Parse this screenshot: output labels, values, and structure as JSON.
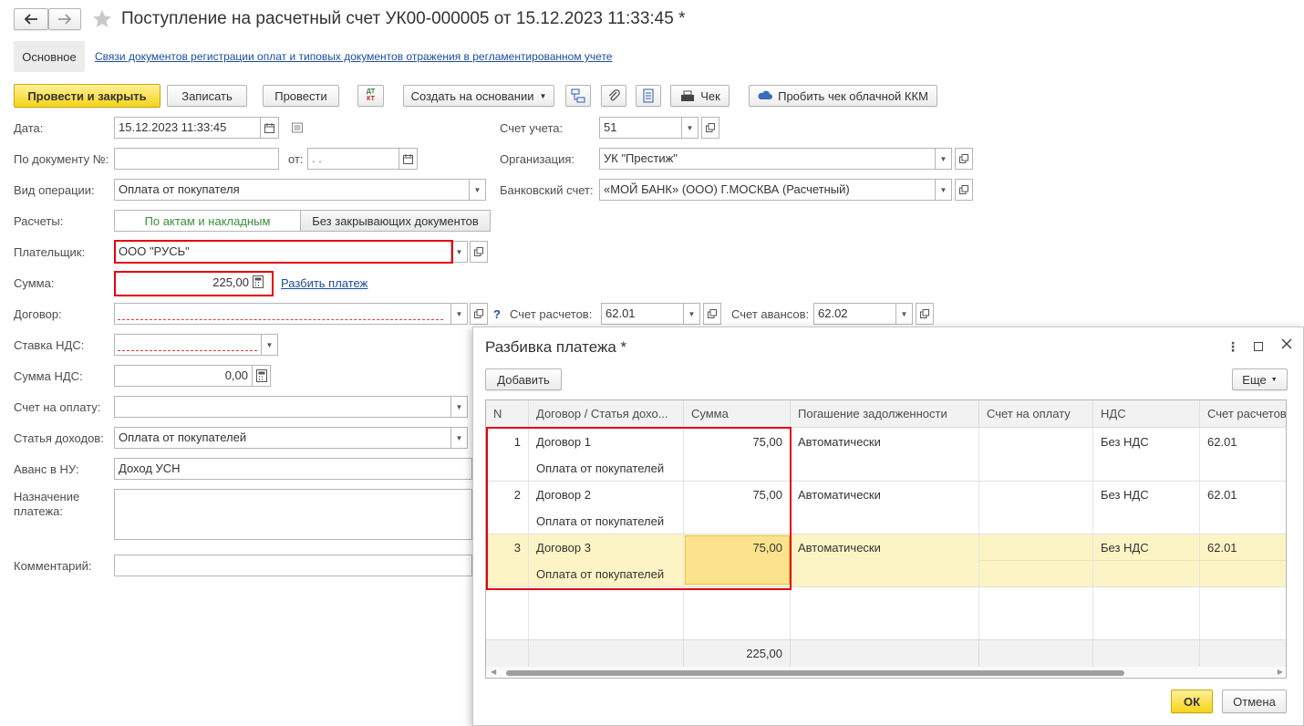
{
  "window": {
    "title": "Поступление на расчетный счет УК00-000005 от 15.12.2023 11:33:45 *"
  },
  "tabs": {
    "main": "Основное",
    "link": "Связи документов регистрации оплат и типовых документов отражения в регламентированном учете"
  },
  "toolbar": {
    "post_close": "Провести и закрыть",
    "save": "Записать",
    "post": "Провести",
    "create_based": "Создать на основании",
    "check": "Чек",
    "cloud_kkm": "Пробить чек облачной ККМ",
    "dt_kt_top": "ДТ",
    "dt_kt_bottom": "КТ"
  },
  "form": {
    "date_label": "Дата:",
    "date_value": "15.12.2023 11:33:45",
    "doc_no_label": "По документу №:",
    "doc_no_value": "",
    "from_label": "от:",
    "from_value": " .  .",
    "op_type_label": "Вид операции:",
    "op_type_value": "Оплата от покупателя",
    "settlements_label": "Расчеты:",
    "settle_opt1": "По актам и накладным",
    "settle_opt2": "Без закрывающих документов",
    "payer_label": "Плательщик:",
    "payer_value": "ООО \"РУСЬ\"",
    "sum_label": "Сумма:",
    "sum_value": "225,00",
    "split_link": "Разбить платеж",
    "contract_label": "Договор:",
    "contract_value": "",
    "help": "?",
    "settle_account_label": "Счет расчетов:",
    "settle_account_value": "62.01",
    "advance_account_label": "Счет авансов:",
    "advance_account_value": "62.02",
    "vat_rate_label": "Ставка НДС:",
    "vat_rate_value": "",
    "vat_sum_label": "Сумма НДС:",
    "vat_sum_value": "0,00",
    "invoice_label": "Счет на оплату:",
    "invoice_value": "",
    "income_item_label": "Статья доходов:",
    "income_item_value": "Оплата от покупателей",
    "advance_nu_label": "Аванс в НУ:",
    "advance_nu_value": "Доход УСН",
    "purpose_label_1": "Назначение",
    "purpose_label_2": "платежа:",
    "comment_label": "Комментарий:",
    "account_label": "Счет учета:",
    "account_value": "51",
    "org_label": "Организация:",
    "org_value": "УК \"Престиж\"",
    "bank_label": "Банковский счет:",
    "bank_value": "«МОЙ БАНК» (ООО) Г.МОСКВА (Расчетный)"
  },
  "dialog": {
    "title": "Разбивка платежа *",
    "add": "Добавить",
    "more": "Еще",
    "ok": "ОК",
    "cancel": "Отмена",
    "columns": [
      "N",
      "Договор / Статья дохо...",
      "Сумма",
      "Погашение задолженности",
      "Счет на оплату",
      "НДС",
      "Счет расчетов"
    ],
    "rows": [
      {
        "n": "1",
        "contract": "Договор 1",
        "item": "Оплата от покупателей",
        "sum": "75,00",
        "repay": "Автоматически",
        "invoice": "",
        "vat": "Без НДС",
        "account": "62.01"
      },
      {
        "n": "2",
        "contract": "Договор 2",
        "item": "Оплата от покупателей",
        "sum": "75,00",
        "repay": "Автоматически",
        "invoice": "",
        "vat": "Без НДС",
        "account": "62.01"
      },
      {
        "n": "3",
        "contract": "Договор 3",
        "item": "Оплата от покупателей",
        "sum": "75,00",
        "repay": "Автоматически",
        "invoice": "",
        "vat": "Без НДС",
        "account": "62.01"
      }
    ],
    "total": "225,00"
  },
  "colors": {
    "accent_yellow": "#f5d417",
    "selected_row": "#fdf4c5",
    "active_cell": "#fbe38e",
    "highlight_red": "#e3000f",
    "link_blue": "#1c4d99",
    "radio_active_green": "#3b8f3b"
  }
}
